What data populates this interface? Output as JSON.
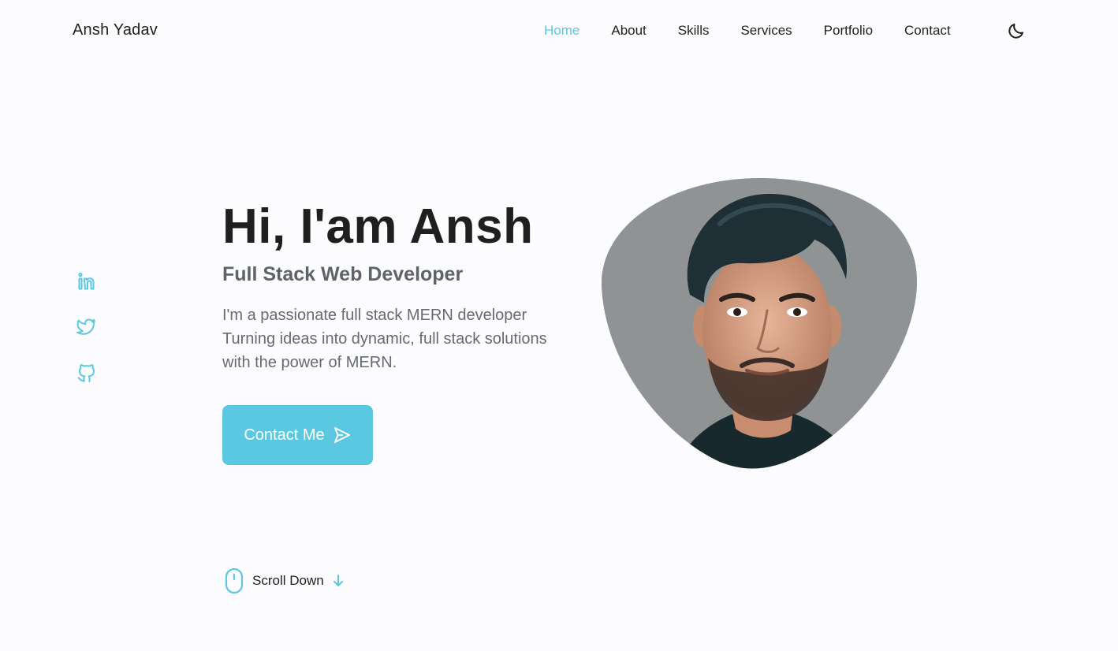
{
  "header": {
    "logo": "Ansh Yadav",
    "nav": [
      {
        "label": "Home",
        "active": true
      },
      {
        "label": "About",
        "active": false
      },
      {
        "label": "Skills",
        "active": false
      },
      {
        "label": "Services",
        "active": false
      },
      {
        "label": "Portfolio",
        "active": false
      },
      {
        "label": "Contact",
        "active": false
      }
    ],
    "theme_icon": "moon-icon"
  },
  "social": [
    {
      "icon": "linkedin-icon"
    },
    {
      "icon": "twitter-icon"
    },
    {
      "icon": "github-icon"
    }
  ],
  "hero": {
    "title": "Hi, I'am Ansh",
    "subtitle": "Full Stack Web Developer",
    "description": "I'm a passionate full stack MERN developer Turning ideas into dynamic, full stack solutions with the power of MERN.",
    "button_label": "Contact Me",
    "button_icon": "send-icon",
    "photo": "profile-photo"
  },
  "scroll": {
    "label": "Scroll Down",
    "icons": [
      "mouse-icon",
      "arrow-down-icon"
    ]
  },
  "colors": {
    "accent": "#5bc8e1",
    "text": "#1f1f1f",
    "muted": "#666b6e",
    "background": "#fcfcfe",
    "photo_bg": "#8f9394"
  }
}
